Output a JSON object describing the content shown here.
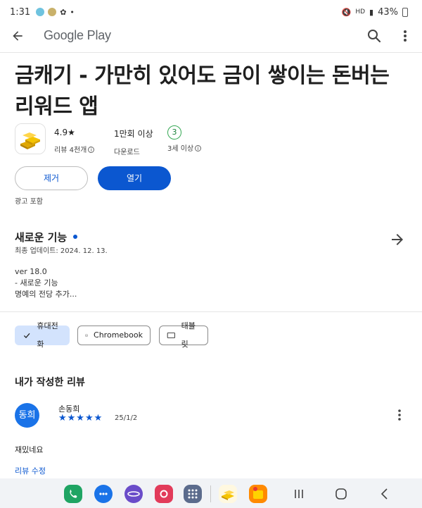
{
  "status_bar": {
    "time": "1:31",
    "battery": "43%"
  },
  "app_bar": {
    "title": "Google Play",
    "back_icon": "arrow-back-icon",
    "search_icon": "search-icon",
    "more_icon": "more-vert-icon"
  },
  "app": {
    "title_line1": "금캐기 - 가만히 있어도 금이 쌓이는 돈버는",
    "title_line2": "리워드 앱",
    "rating_value": "4.9★",
    "rating_label": "리뷰 4천개",
    "downloads_value": "1만회 이상",
    "downloads_label": "다운로드",
    "age_value": "3",
    "age_label": "3세 이상"
  },
  "actions": {
    "remove_label": "제거",
    "open_label": "열기",
    "ads_note": "광고 포함"
  },
  "whats_new": {
    "title": "새로운 기능",
    "date": "최종 업데이트: 2024. 12. 13.",
    "line1": "ver 18.0",
    "line2": "- 새로운 기능",
    "line3": "명예의 전당 추가..."
  },
  "devices": {
    "phone": "휴대전화",
    "chromebook": "Chromebook",
    "tablet": "태블릿"
  },
  "my_review": {
    "heading": "내가 작성한 리뷰",
    "avatar_text": "동희",
    "name": "손동희",
    "stars": "★★★★★",
    "date": "25/1/2",
    "text": "재밌네요",
    "edit_label": "리뷰 수정"
  },
  "colors": {
    "accent": "#0b57d0",
    "chip_selected": "#d3e3fd",
    "age_green": "#34a853",
    "avatar": "#1a73e8"
  }
}
